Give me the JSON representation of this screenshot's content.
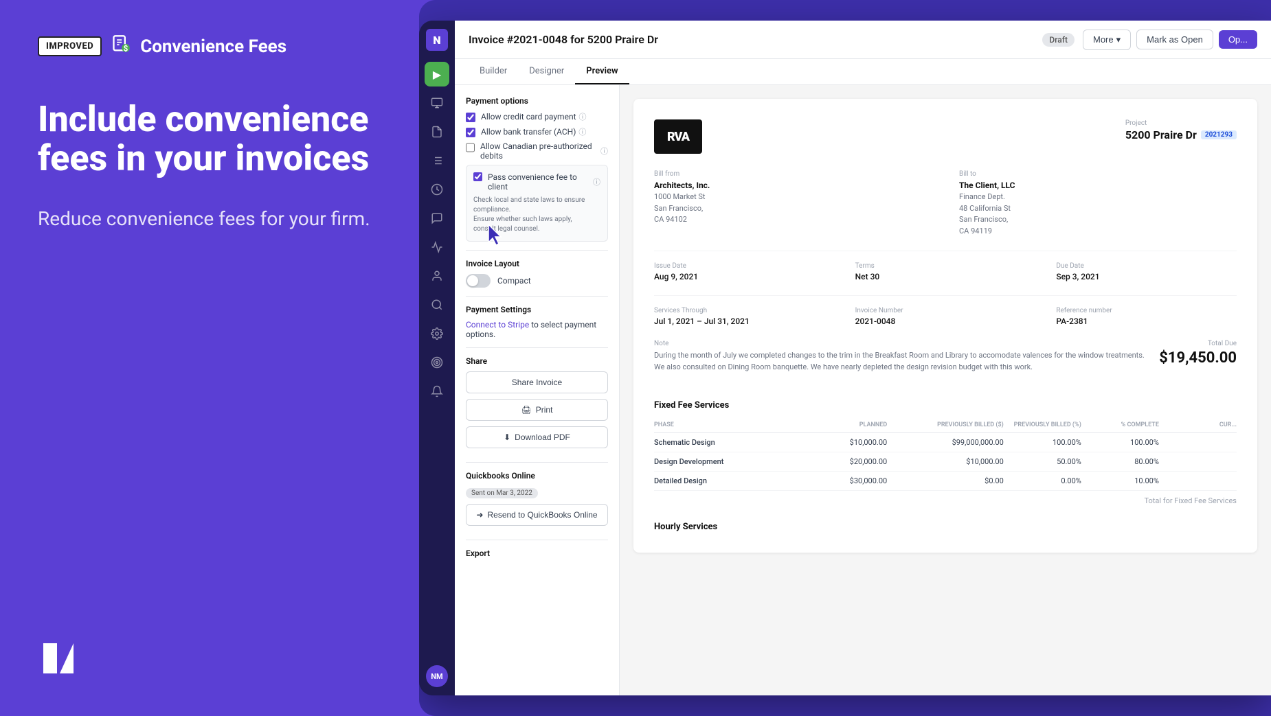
{
  "left_panel": {
    "badge": "IMPROVED",
    "icon_label": "invoice-icon",
    "title": "Convenience Fees",
    "headline": "Include convenience fees in your invoices",
    "subheadline": "Reduce convenience fees for your firm."
  },
  "app": {
    "invoice_title": "Invoice #2021-0048 for 5200 Praire Dr",
    "status": "Draft",
    "buttons": {
      "more": "More",
      "mark_as_open": "Mark as Open",
      "options": "Op..."
    },
    "tabs": [
      "Builder",
      "Designer",
      "Preview"
    ],
    "active_tab": "Preview"
  },
  "sidebar": {
    "logo": "N",
    "avatar": "NM",
    "icons": [
      "▶",
      "⊟",
      "☰",
      "≡",
      "⏱",
      "💬",
      "📈",
      "👤",
      "🔍",
      "⚙",
      "🎯",
      "🔔"
    ]
  },
  "payment_options": {
    "title": "Payment options",
    "options": [
      {
        "label": "Allow credit card payment",
        "checked": true
      },
      {
        "label": "Allow bank transfer (ACH)",
        "checked": true
      },
      {
        "label": "Allow Canadian pre-authorized debits",
        "checked": false
      }
    ],
    "convenience_fee": {
      "label": "Pass convenience fee to client",
      "checked": true,
      "warning": "Check local and state laws to ensure compliance.\nEnsure whether such laws apply,\nconsult legal counsel."
    }
  },
  "invoice_layout": {
    "title": "Invoice Layout",
    "toggle_label": "Compact",
    "toggle_on": false
  },
  "payment_settings": {
    "title": "Payment Settings",
    "link_text": "Connect to Stripe",
    "link_suffix": " to select payment options."
  },
  "share": {
    "title": "Share",
    "share_invoice_btn": "Share Invoice",
    "print_btn": "Print",
    "download_btn": "Download PDF"
  },
  "quickbooks": {
    "title": "Quickbooks Online",
    "badge": "Sent on Mar 3, 2022",
    "resend_btn": "Resend to QuickBooks Online"
  },
  "export": {
    "title": "Export"
  },
  "invoice": {
    "logo_text": "RVA",
    "project_label": "Project",
    "project_name": "5200 Praire Dr",
    "project_badge": "2021293",
    "bill_from": {
      "label": "Bill from",
      "company": "Architects, Inc.",
      "address": "1000 Market St\nSan Francisco,\nCA 94102"
    },
    "bill_to": {
      "label": "Bill to",
      "company": "The Client, LLC",
      "address": "Finance Dept.\n48 California St\nSan Francisco,\nCA 94119"
    },
    "issue_date_label": "Issue Date",
    "issue_date": "Aug 9, 2021",
    "terms_label": "Terms",
    "terms": "Net 30",
    "due_date_label": "Due Date",
    "due_date": "Sep 3, 2021",
    "services_through_label": "Services Through",
    "services_through": "Jul 1, 2021 – Jul 31, 2021",
    "invoice_number_label": "Invoice Number",
    "invoice_number": "2021-0048",
    "reference_label": "Reference number",
    "reference": "PA-2381",
    "note_label": "Note",
    "note_text": "During the month of July we completed changes to the trim in the Breakfast Room and Library to accomodate valences for the window treatments. We also consulted on Dining Room banquette. We have nearly depleted the design revision budget with this work.",
    "total_label": "Total Due",
    "total_amount": "$19,450.00",
    "fixed_fee_title": "Fixed Fee Services",
    "table_headers": [
      "PHASE",
      "PLANNED",
      "PREVIOUSLY BILLED ($)",
      "PREVIOUSLY BILLED (%)",
      "% COMPLETE",
      "CUR..."
    ],
    "table_rows": [
      {
        "phase": "Schematic Design",
        "planned": "$10,000.00",
        "prev_billed_amt": "$99,000,000.00",
        "prev_billed_pct": "100.00%",
        "pct_complete": "100.00%"
      },
      {
        "phase": "Design Development",
        "planned": "$20,000.00",
        "prev_billed_amt": "$10,000.00",
        "prev_billed_pct": "50.00%",
        "pct_complete": "80.00%"
      },
      {
        "phase": "Detailed Design",
        "planned": "$30,000.00",
        "prev_billed_amt": "$0.00",
        "prev_billed_pct": "0.00%",
        "pct_complete": "10.00%"
      }
    ],
    "fixed_fee_footer": "Total for Fixed Fee Services",
    "hourly_title": "Hourly Services"
  }
}
